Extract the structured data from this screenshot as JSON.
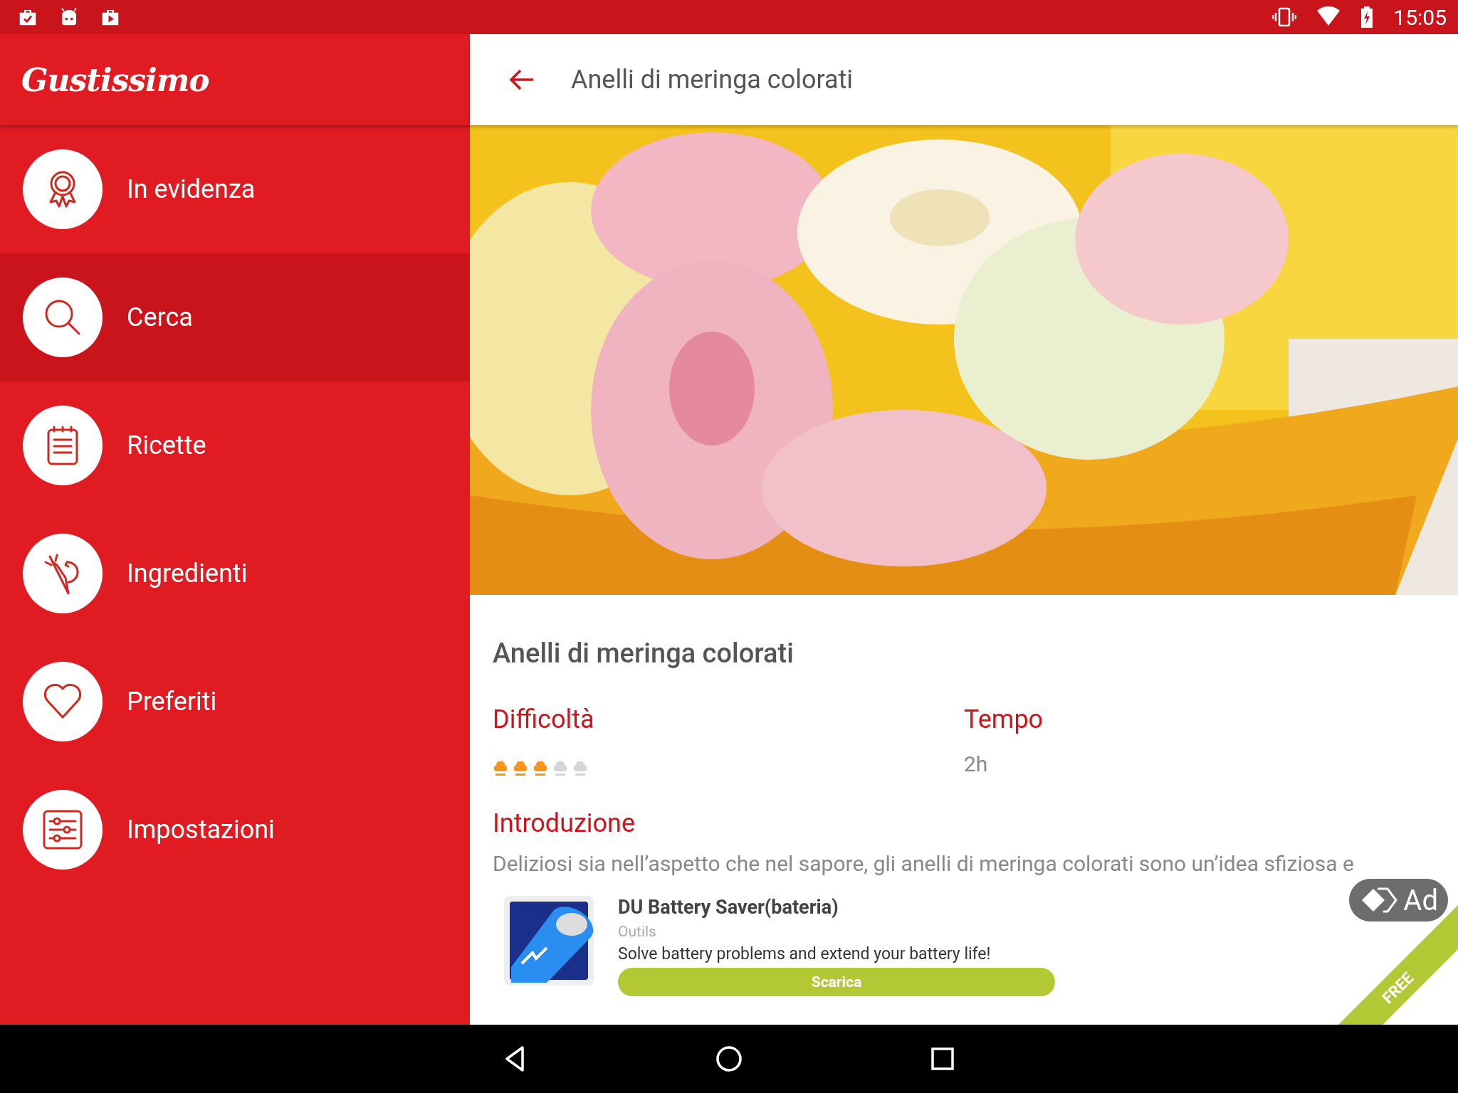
{
  "status_bar": {
    "time": "15:05"
  },
  "drawer": {
    "logo": "Gustissimo",
    "items": [
      {
        "label": "In evidenza",
        "selected": false
      },
      {
        "label": "Cerca",
        "selected": true
      },
      {
        "label": "Ricette",
        "selected": false
      },
      {
        "label": "Ingredienti",
        "selected": false
      },
      {
        "label": "Preferiti",
        "selected": false
      },
      {
        "label": "Impostazioni",
        "selected": false
      }
    ]
  },
  "toolbar": {
    "title": "Anelli di meringa colorati"
  },
  "recipe": {
    "title": "Anelli di meringa colorati",
    "difficulty_label": "Difficoltà",
    "stars": 3,
    "time_label": "Tempo",
    "time": "2h",
    "intro_label": "Introduzione",
    "intro": "Deliziosi sia nell’aspetto che nel sapore, gli anelli di meringa colorati sono un’idea sfiziosa e"
  },
  "ad": {
    "title": "DU Battery Saver(bateria)",
    "category": "Outils",
    "description": "Solve battery problems and extend your battery life!",
    "button": "Scarica",
    "badge": "Ad",
    "ribbon": "FREE"
  }
}
